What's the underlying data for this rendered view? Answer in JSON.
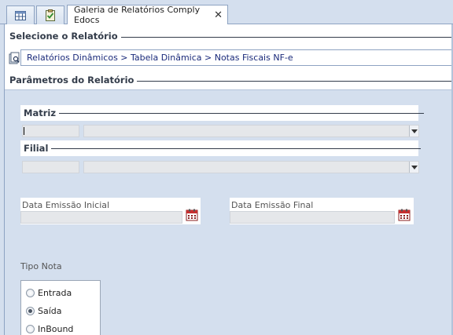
{
  "tabs": {
    "icon1": "grid-report-icon",
    "icon2": "checklist-icon",
    "active_label": "Galeria de Relatórios Comply Edocs",
    "close_glyph": "✕"
  },
  "report_select": {
    "title": "Selecione o Relatório",
    "path": "Relatórios Dinâmicos > Tabela Dinâmica > Notas Fiscais NF-e"
  },
  "params": {
    "title": "Parâmetros do Relatório",
    "matriz": {
      "label": "Matriz",
      "code": "",
      "name": ""
    },
    "filial": {
      "label": "Filial",
      "code": "",
      "name": ""
    },
    "data_inicial": {
      "label": "Data Emissão Inicial",
      "value": ""
    },
    "data_final": {
      "label": "Data Emissão Final",
      "value": ""
    },
    "tipo_nota": {
      "label": "Tipo Nota",
      "options": [
        "Entrada",
        "Saída",
        "InBound"
      ],
      "selected": "Saída"
    }
  },
  "colors": {
    "panel_bg": "#d4dfee",
    "border": "#8ea3c2",
    "path_text": "#1a2a7a"
  }
}
